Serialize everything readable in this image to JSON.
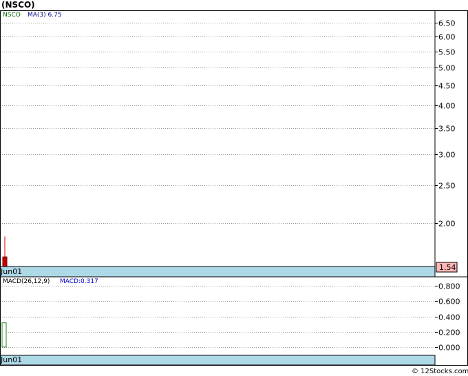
{
  "title": "(NSCO)",
  "footer": "© 12Stocks.com",
  "colors": {
    "background": "#ffffff",
    "panel_border": "#000000",
    "grid": "#999999",
    "date_band": "#add8e6",
    "price_box": "#ffb6b6",
    "legend_symbol": "#006400",
    "legend_ma": "#00008b",
    "down_candle": "#cc0000",
    "macd_box": "#228b22"
  },
  "price_panel": {
    "legend_symbol": "NSCO",
    "legend_ma": "MA(3)  6.75",
    "date_label": "Jun01",
    "last_price": "1.54"
  },
  "macd_panel": {
    "legend_macd": "MACD(26,12,9)",
    "legend_value": "MACD:0.317",
    "date_label": "Jun01"
  },
  "chart_data": [
    {
      "type": "candlestick",
      "title": "(NSCO)",
      "scale": "log",
      "grid": true,
      "ylim": [
        1.55,
        7.0
      ],
      "ticks": [
        6.5,
        6.0,
        5.5,
        5.0,
        4.5,
        4.0,
        3.5,
        3.0,
        2.5,
        2.0
      ],
      "tick_labels": [
        "6.50",
        "6.00",
        "5.50",
        "5.00",
        "4.50",
        "4.00",
        "3.50",
        "3.00",
        "2.50",
        "2.00"
      ],
      "candles": [
        {
          "date": "Jun01",
          "open": 1.64,
          "high": 1.85,
          "low": 1.52,
          "close": 1.54,
          "direction": "down"
        }
      ],
      "ma": {
        "period": 3,
        "value": 6.75
      }
    },
    {
      "type": "bar",
      "title": "MACD(26,12,9)",
      "grid": true,
      "ylim": [
        -0.1,
        0.9
      ],
      "ticks": [
        0.8,
        0.6,
        0.4,
        0.2,
        0.0
      ],
      "tick_labels": [
        "0.800",
        "0.600",
        "0.400",
        "0.200",
        "0.000"
      ],
      "bars": [
        {
          "date": "Jun01",
          "value": 0.317
        }
      ]
    }
  ]
}
